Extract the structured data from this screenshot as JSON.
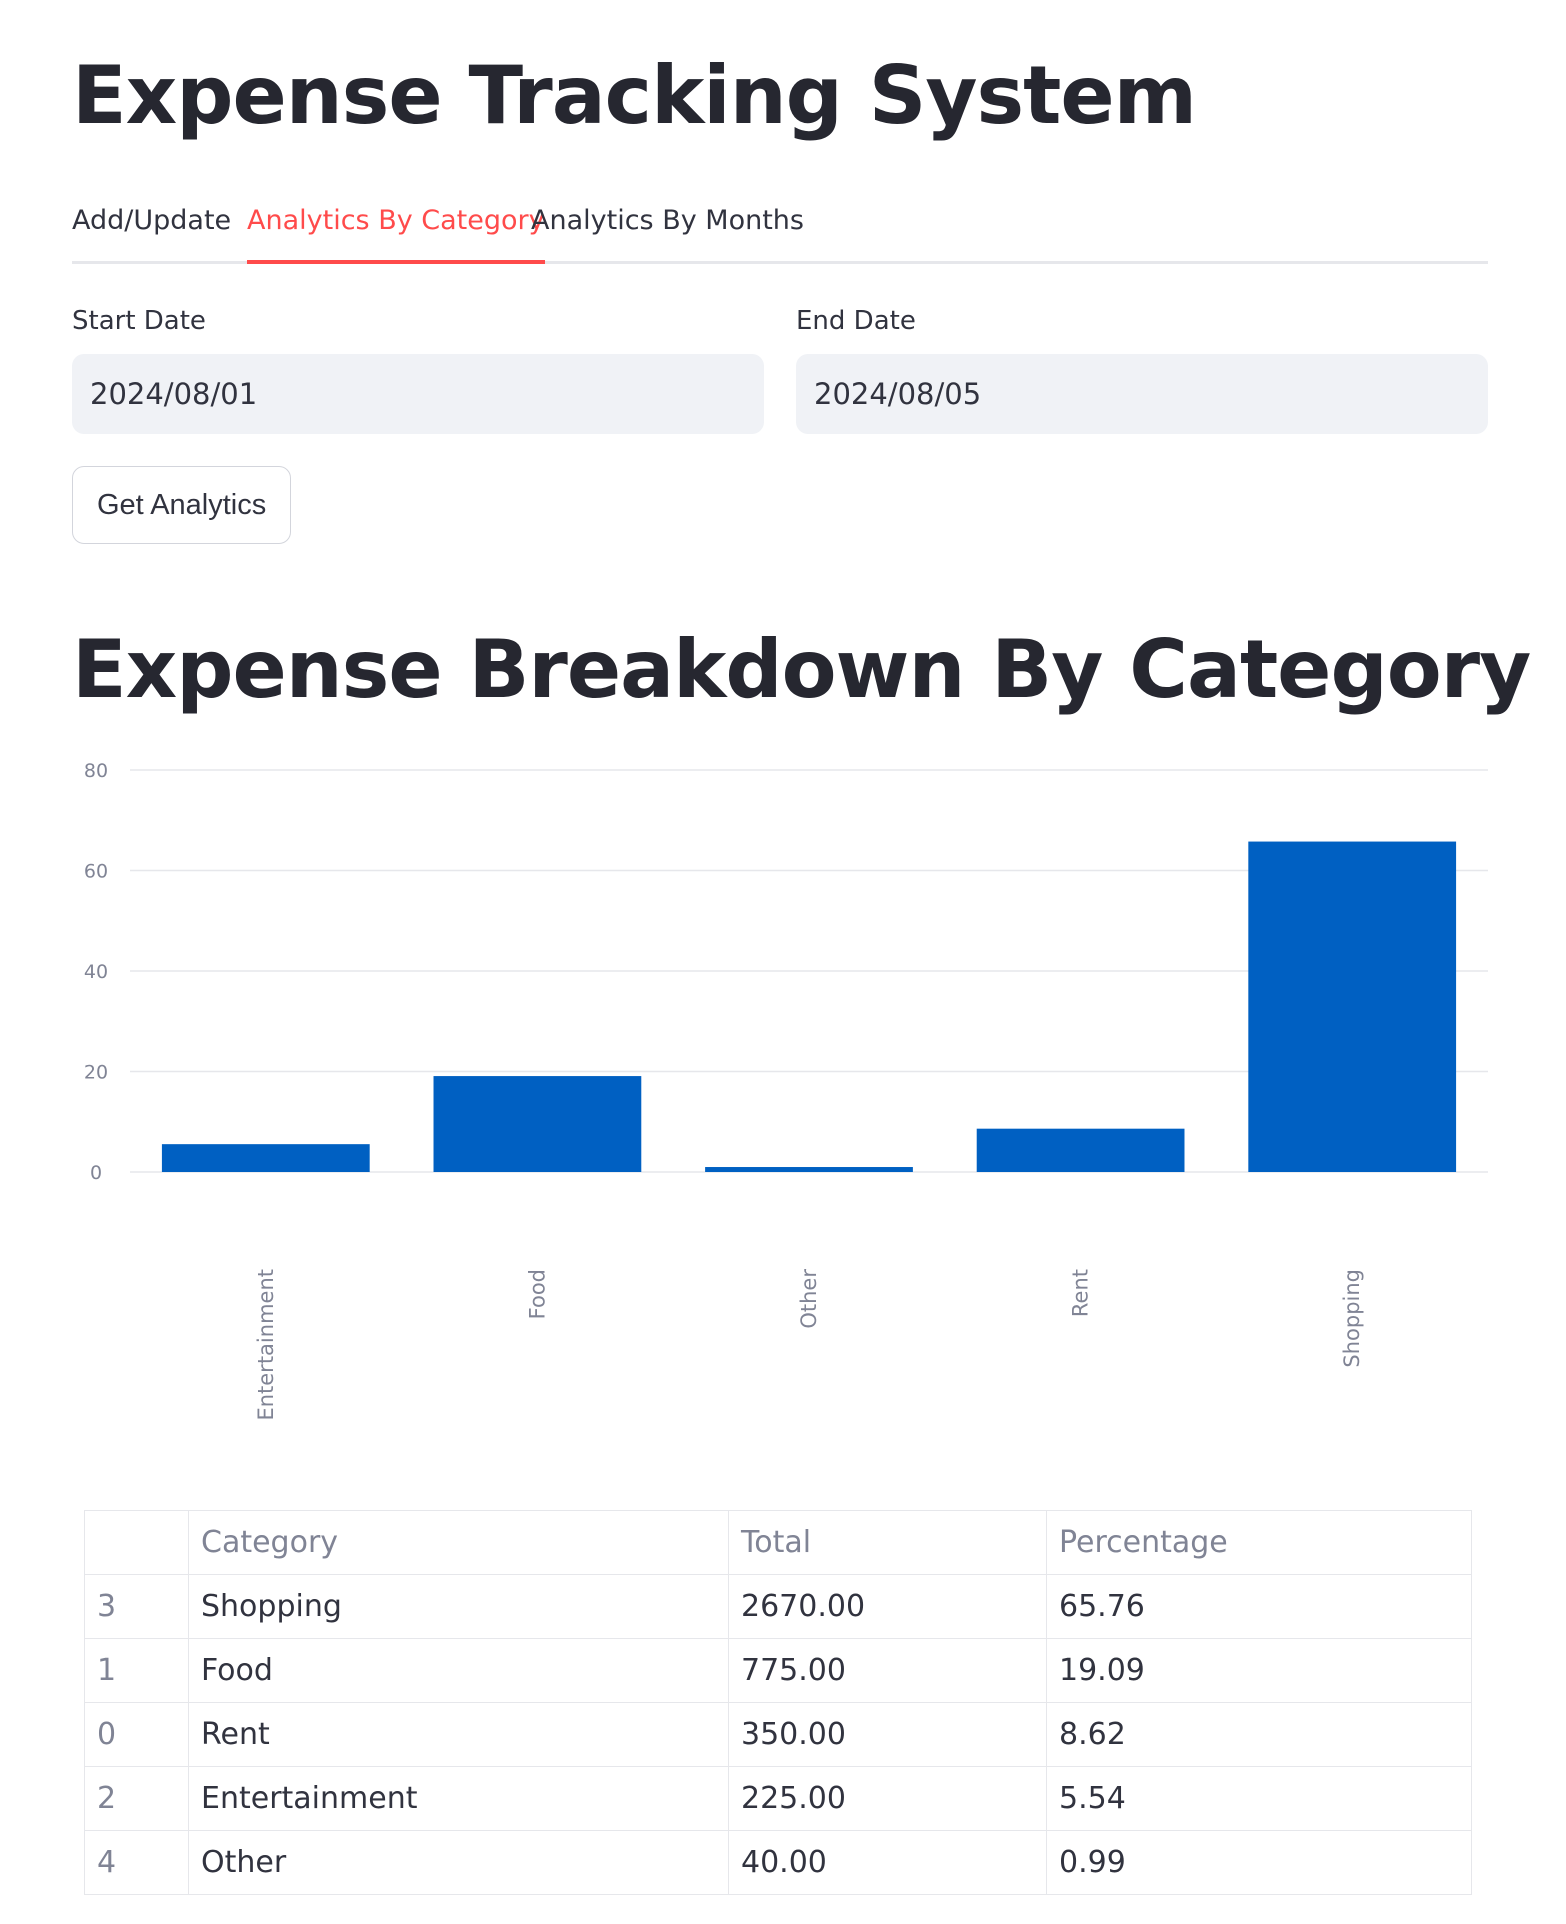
{
  "app": {
    "title": "Expense Tracking System"
  },
  "tabs": [
    {
      "label": "Add/Update",
      "active": false
    },
    {
      "label": "Analytics By Category",
      "active": true
    },
    {
      "label": "Analytics By Months",
      "active": false
    }
  ],
  "filters": {
    "start_label": "Start Date",
    "start_value": "2024/08/01",
    "end_label": "End Date",
    "end_value": "2024/08/05",
    "button_label": "Get Analytics"
  },
  "section": {
    "title": "Expense Breakdown By Category"
  },
  "colors": {
    "accent": "#ff4b4b",
    "bar": "#0060c2",
    "grid": "#e6e7eb"
  },
  "chart_data": {
    "type": "bar",
    "categories": [
      "Entertainment",
      "Food",
      "Other",
      "Rent",
      "Shopping"
    ],
    "values": [
      5.54,
      19.09,
      0.99,
      8.62,
      65.76
    ],
    "ylim": [
      0,
      80
    ],
    "yticks": [
      0,
      20,
      40,
      60,
      80
    ],
    "grid": true,
    "title": "",
    "xlabel": "",
    "ylabel": ""
  },
  "table": {
    "headers": [
      "",
      "Category",
      "Total",
      "Percentage"
    ],
    "rows": [
      [
        "3",
        "Shopping",
        "2670.00",
        "65.76"
      ],
      [
        "1",
        "Food",
        "775.00",
        "19.09"
      ],
      [
        "0",
        "Rent",
        "350.00",
        "8.62"
      ],
      [
        "2",
        "Entertainment",
        "225.00",
        "5.54"
      ],
      [
        "4",
        "Other",
        "40.00",
        "0.99"
      ]
    ]
  }
}
